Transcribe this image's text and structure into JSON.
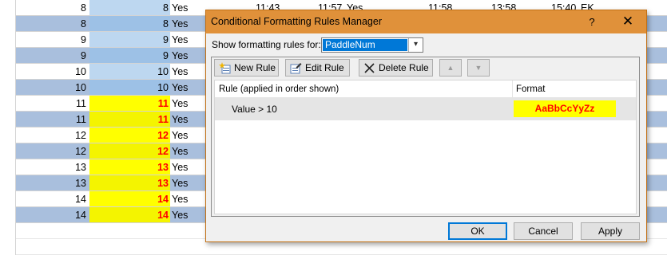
{
  "sheet": {
    "top_row": {
      "a": "8",
      "b": "8",
      "c": "Yes",
      "t1": "11:43",
      "t2": "11:57",
      "t2s": "Yes",
      "t3": "11:58",
      "t4": "13:58",
      "t5": "15:40",
      "t5s": "EK"
    },
    "rows": [
      {
        "a": "8",
        "b": "8",
        "c": "Yes"
      },
      {
        "a": "9",
        "b": "9",
        "c": "Yes"
      },
      {
        "a": "9",
        "b": "9",
        "c": "Yes"
      },
      {
        "a": "10",
        "b": "10",
        "c": "Yes"
      },
      {
        "a": "10",
        "b": "10",
        "c": "Yes"
      },
      {
        "a": "11",
        "b": "11",
        "c": "Yes"
      },
      {
        "a": "11",
        "b": "11",
        "c": "Yes"
      },
      {
        "a": "12",
        "b": "12",
        "c": "Yes"
      },
      {
        "a": "12",
        "b": "12",
        "c": "Yes"
      },
      {
        "a": "13",
        "b": "13",
        "c": "Yes"
      },
      {
        "a": "13",
        "b": "13",
        "c": "Yes"
      },
      {
        "a": "14",
        "b": "14",
        "c": "Yes"
      },
      {
        "a": "14",
        "b": "14",
        "c": "Yes"
      }
    ]
  },
  "dialog": {
    "title": "Conditional Formatting Rules Manager",
    "help": "?",
    "close": "✕",
    "show_label": "Show formatting rules for:",
    "show_value": "PaddleNum",
    "toolbar": {
      "new_rule": "New Rule",
      "edit_rule": "Edit Rule",
      "delete_rule": "Delete Rule",
      "move_up": "▲",
      "move_down": "▼"
    },
    "table": {
      "col_rule": "Rule (applied in order shown)",
      "col_format": "Format",
      "rule_text": "Value > 10",
      "format_preview": "AaBbCcYyZz"
    },
    "buttons": {
      "ok": "OK",
      "cancel": "Cancel",
      "apply": "Apply"
    }
  },
  "colors": {
    "title_bar": "#e0913a",
    "band": "#a9bfdd",
    "highlight_yellow": "#ffff00",
    "highlight_red": "#ff0000",
    "focus_blue": "#0078d7"
  }
}
